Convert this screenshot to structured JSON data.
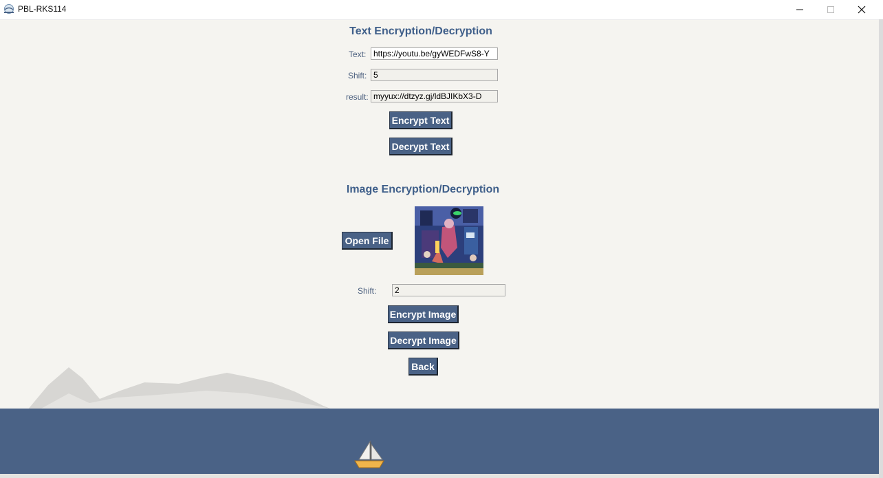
{
  "window": {
    "title": "PBL-RKS114"
  },
  "text_section": {
    "heading": "Text Encryption/Decryption",
    "text_label": "Text:",
    "text_value": "https://youtu.be/gyWEDFwS8-Y",
    "shift_label": "Shift:",
    "shift_value": "5",
    "result_label": "result:",
    "result_value": "myyux://dtzyz.gj/ldBJIKbX3-D",
    "encrypt_label": "Encrypt Text",
    "decrypt_label": "Decrypt Text"
  },
  "image_section": {
    "heading": "Image Encryption/Decryption",
    "open_file_label": "Open File",
    "shift_label": "Shift:",
    "shift_value": "2",
    "encrypt_label": "Encrypt Image",
    "decrypt_label": "Decrypt Image",
    "back_label": "Back"
  },
  "colors": {
    "background": "#f5f4f0",
    "accent": "#4a6286",
    "heading": "#3f5f8a"
  }
}
